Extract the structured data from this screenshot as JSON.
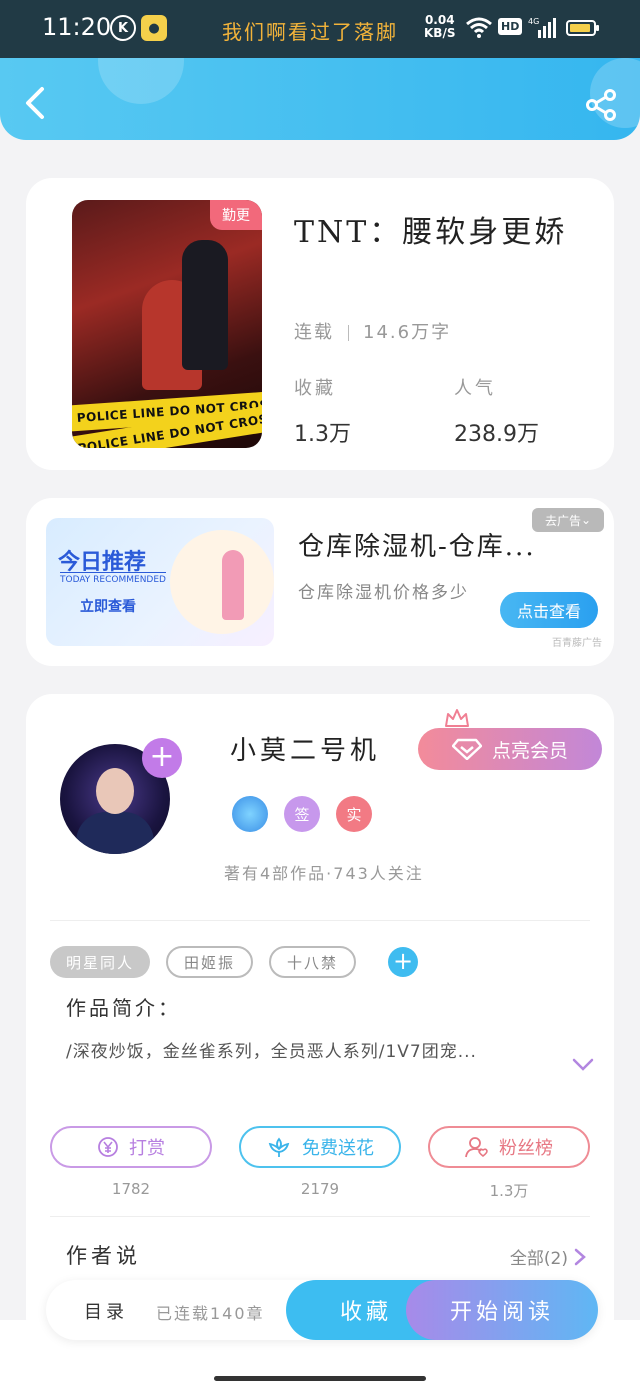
{
  "status_bar": {
    "time": "11:20",
    "k_icon": "K",
    "scroll_text": "我们啊看过了落脚",
    "speed_value": "0.04",
    "speed_unit": "KB/S",
    "hd_label": "HD",
    "network_label": "4G"
  },
  "header": {
    "back_icon": "chevron-left-icon",
    "share_icon": "share-icon",
    "accent": "#35b6ef"
  },
  "book": {
    "badge": "勤更",
    "cover_tape_text": "POLICE LINE DO NOT CROSS",
    "title": "TNT：腰软身更娇",
    "status": "连载",
    "word_count": "14.6万字",
    "fav_label": "收藏",
    "fav_value": "1.3万",
    "pop_label": "人气",
    "pop_value": "238.9万"
  },
  "ad": {
    "image_title": "今日推荐",
    "image_subtitle": "TODAY RECOMMENDED",
    "image_cta": "立即查看",
    "close_label": "去广告",
    "title": "仓库除湿机-仓库...",
    "description": "仓库除湿机价格多少",
    "button": "点击查看",
    "source": "百青藤广告"
  },
  "author": {
    "name": "小莫二号机",
    "vip_button": "点亮会员",
    "badges": [
      "",
      "签",
      "实"
    ],
    "stats": "著有4部作品·743人关注",
    "tags": [
      "明星同人",
      "田姬振",
      "十八禁"
    ],
    "intro_title": "作品简介：",
    "intro_text": "/深夜炒饭，金丝雀系列，全员恶人系列/1V7团宠...",
    "actions": [
      {
        "label": "打赏",
        "count": "1782",
        "icon": "yen-icon"
      },
      {
        "label": "免费送花",
        "count": "2179",
        "icon": "flower-icon"
      },
      {
        "label": "粉丝榜",
        "count": "1.3万",
        "icon": "fans-icon"
      }
    ],
    "say_title": "作者说",
    "say_all": "全部(2)"
  },
  "bottom_bar": {
    "toc": "目录",
    "chapter_status": "已连载140章",
    "favorite": "收藏",
    "start_reading": "开始阅读"
  }
}
